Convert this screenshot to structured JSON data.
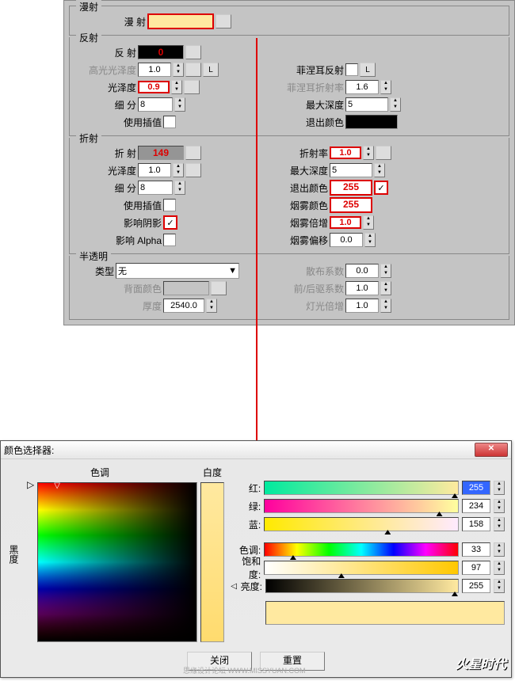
{
  "diffuse": {
    "title": "漫射",
    "label": "漫  射",
    "color": "#ffe9a0"
  },
  "reflect": {
    "title": "反射",
    "label": "反  射",
    "value": "0",
    "color": "#000",
    "gloss_hi_label": "高光光泽度",
    "gloss_hi": "1.0",
    "gloss_label": "光泽度",
    "gloss": "0.9",
    "subdiv_label": "细  分",
    "subdiv": "8",
    "interp_label": "使用插值",
    "fresnel_label": "菲涅耳反射",
    "fresnel_ior_label": "菲涅耳折射率",
    "fresnel_ior": "1.6",
    "maxdepth_label": "最大深度",
    "maxdepth": "5",
    "exitcolor_label": "退出颜色",
    "exitcolor": "#000",
    "l_btn": "L"
  },
  "refract": {
    "title": "折射",
    "label": "折  射",
    "value": "149",
    "gloss_label": "光泽度",
    "gloss": "1.0",
    "subdiv_label": "细  分",
    "subdiv": "8",
    "interp_label": "使用插值",
    "shadows_label": "影响阴影",
    "alpha_label": "影响 Alpha",
    "ior_label": "折射率",
    "ior": "1.0",
    "maxdepth_label": "最大深度",
    "maxdepth": "5",
    "exitcolor_label": "退出颜色",
    "exitcolor_val": "255",
    "fogcolor_label": "烟雾颜色",
    "fogcolor_val": "255",
    "fogmult_label": "烟雾倍增",
    "fogmult": "1.0",
    "fogbias_label": "烟雾偏移",
    "fogbias": "0.0"
  },
  "translucency": {
    "title": "半透明",
    "type_label": "类型",
    "type_val": "无",
    "backcolor_label": "背面颜色",
    "thickness_label": "厚度",
    "thickness": "2540.0",
    "scatter_label": "散布系数",
    "scatter": "0.0",
    "fwdback_label": "前/后驱系数",
    "fwdback": "1.0",
    "lightmult_label": "灯光倍增",
    "lightmult": "1.0"
  },
  "picker": {
    "title": "颜色选择器:",
    "hue_label": "色调",
    "whiteness_label": "白度",
    "blackness_label": "黑度",
    "red_label": "红:",
    "red": "255",
    "green_label": "绿:",
    "green": "234",
    "blue_label": "蓝:",
    "blue": "158",
    "hue2_label": "色调:",
    "hue": "33",
    "sat_label": "饱和度:",
    "sat": "97",
    "bri_label": "亮度:",
    "bri": "255",
    "preview_color": "#ffe9a0",
    "close_btn": "关闭",
    "reset_btn": "重置"
  },
  "watermark1": "思缘设计论坛  WWW.MISSYUAN.COM",
  "watermark2": "火星时代"
}
